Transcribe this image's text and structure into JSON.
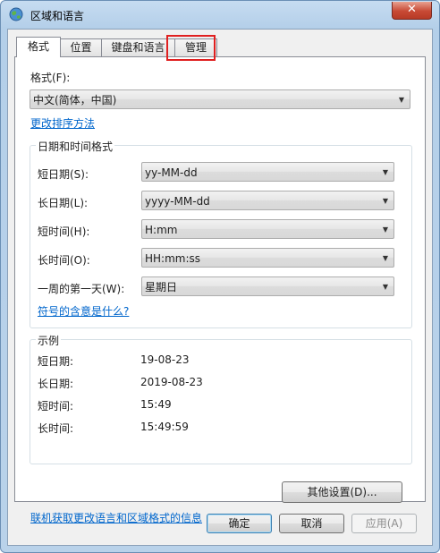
{
  "window": {
    "title": "区域和语言",
    "close_label": "✕"
  },
  "tabs": [
    {
      "label": "格式"
    },
    {
      "label": "位置"
    },
    {
      "label": "键盘和语言"
    },
    {
      "label": "管理"
    }
  ],
  "format": {
    "label": "格式(F):",
    "value": "中文(简体，中国)",
    "sort_link": "更改排序方法"
  },
  "datetime_group": {
    "title": "日期和时间格式",
    "rows": [
      {
        "label": "短日期(S):",
        "value": "yy-MM-dd"
      },
      {
        "label": "长日期(L):",
        "value": "yyyy-MM-dd"
      },
      {
        "label": "短时间(H):",
        "value": "H:mm"
      },
      {
        "label": "长时间(O):",
        "value": "HH:mm:ss"
      },
      {
        "label": "一周的第一天(W):",
        "value": "星期日"
      }
    ],
    "symbols_link": "符号的含意是什么?"
  },
  "example_group": {
    "title": "示例",
    "rows": [
      {
        "label": "短日期:",
        "value": "19-08-23"
      },
      {
        "label": "长日期:",
        "value": "2019-08-23"
      },
      {
        "label": "短时间:",
        "value": "15:49"
      },
      {
        "label": "长时间:",
        "value": "15:49:59"
      }
    ]
  },
  "other_settings_button": "其他设置(D)...",
  "online_link": "联机获取更改语言和区域格式的信息",
  "buttons": {
    "ok": "确定",
    "cancel": "取消",
    "apply": "应用(A)"
  },
  "highlight": {
    "target": "管理",
    "color": "#e02020"
  }
}
